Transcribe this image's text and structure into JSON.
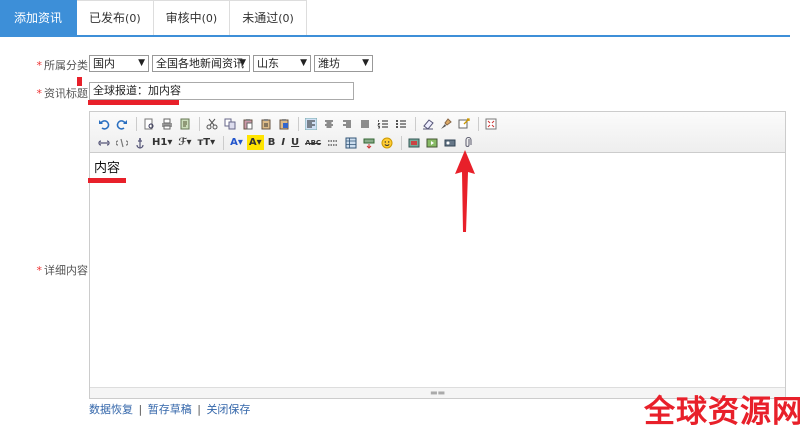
{
  "tabs": [
    {
      "label": "添加资讯",
      "count": ""
    },
    {
      "label": "已发布",
      "count": "(0)"
    },
    {
      "label": "审核中",
      "count": "(0)"
    },
    {
      "label": "未通过",
      "count": "(0)"
    }
  ],
  "labels": {
    "category": "所属分类",
    "title": "资讯标题",
    "detail": "详细内容",
    "required_mark": "*"
  },
  "selects": {
    "region": "国内",
    "channel": "全国各地新闻资讯",
    "province": "山东",
    "city": "潍坊"
  },
  "title_value": "全球报道：加内容",
  "editor": {
    "content": "内容",
    "toolbar_row1": [
      "undo-icon",
      "redo-icon",
      "sep",
      "preview-icon",
      "print-icon",
      "template-icon",
      "sep",
      "cut-icon",
      "copy-icon",
      "paste-icon",
      "paste-text-icon",
      "paste-word-icon",
      "sep",
      "align-left-icon",
      "align-center-icon",
      "align-right-icon",
      "align-justify-icon",
      "ordered-list-icon",
      "unordered-list-icon",
      "sep",
      "eraser-icon",
      "brush-icon",
      "select-all-icon",
      "sep",
      "fullscreen-icon"
    ],
    "toolbar_row2_text": {
      "heading": "H1",
      "font": "ℱ",
      "size": "тT",
      "forecolor": "A",
      "hilite": "A",
      "bold": "B",
      "italic": "I",
      "underline": "U",
      "strike": "ABC"
    }
  },
  "footer": {
    "restore": "数据恢复",
    "draft": "暂存草稿",
    "close_save": "关闭保存",
    "separator": "|"
  },
  "watermark": "全球资源网",
  "colors": {
    "accent": "#3d8fd8",
    "highlight": "#e8202a",
    "link": "#3366aa"
  }
}
